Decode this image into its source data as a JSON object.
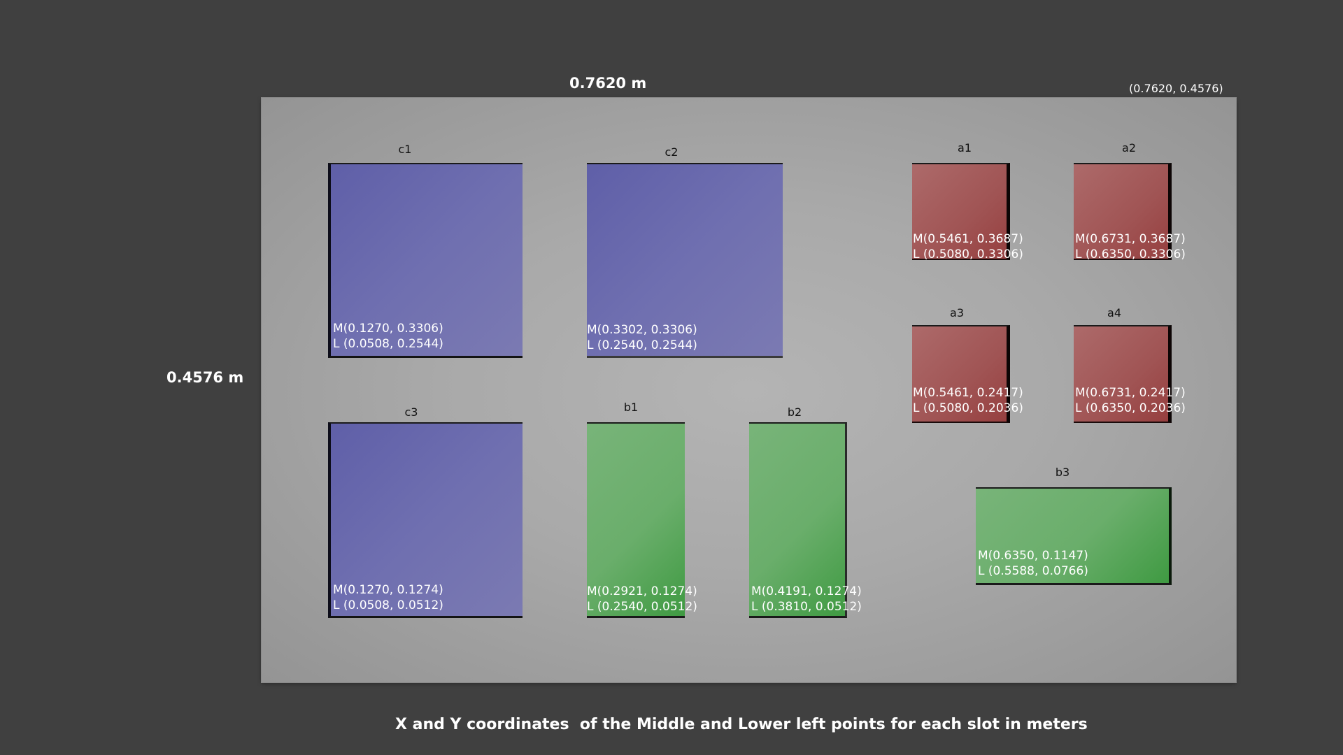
{
  "dimensions": {
    "width_label": "0.7620 m",
    "height_label": "0.4576 m",
    "corner_label": "(0.7620, 0.4576)"
  },
  "caption": "X and Y coordinates  of the Middle and Lower left points for each slot in meters",
  "slots": {
    "c1": {
      "name": "c1",
      "middle": "M(0.1270, 0.3306)",
      "lower_left": "L (0.0508, 0.2544)"
    },
    "c2": {
      "name": "c2",
      "middle": "M(0.3302, 0.3306)",
      "lower_left": "L (0.2540, 0.2544)"
    },
    "c3": {
      "name": "c3",
      "middle": "M(0.1270, 0.1274)",
      "lower_left": "L (0.0508, 0.0512)"
    },
    "a1": {
      "name": "a1",
      "middle": "M(0.5461, 0.3687)",
      "lower_left": "L (0.5080, 0.3306)"
    },
    "a2": {
      "name": "a2",
      "middle": "M(0.6731, 0.3687)",
      "lower_left": "L (0.6350, 0.3306)"
    },
    "a3": {
      "name": "a3",
      "middle": "M(0.5461, 0.2417)",
      "lower_left": "L (0.5080, 0.2036)"
    },
    "a4": {
      "name": "a4",
      "middle": "M(0.6731, 0.2417)",
      "lower_left": "L (0.6350, 0.2036)"
    },
    "b1": {
      "name": "b1",
      "middle": "M(0.2921, 0.1274)",
      "lower_left": "L (0.2540, 0.0512)"
    },
    "b2": {
      "name": "b2",
      "middle": "M(0.4191, 0.1274)",
      "lower_left": "L (0.3810, 0.0512)"
    },
    "b3": {
      "name": "b3",
      "middle": "M(0.6350, 0.1147)",
      "lower_left": "L (0.5588, 0.0766)"
    }
  },
  "colors": {
    "background": "#404040",
    "board": "#aaaaaa",
    "slot_c": "#6b6bb0",
    "slot_a": "#a55a5a",
    "slot_b": "#6cb06d"
  }
}
